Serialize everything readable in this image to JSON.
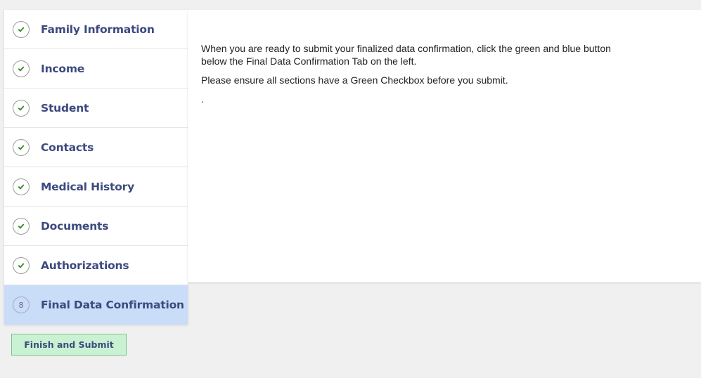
{
  "sidebar": {
    "items": [
      {
        "label": "Family Information",
        "status": "complete",
        "icon": "checkmark-icon"
      },
      {
        "label": "Income",
        "status": "complete",
        "icon": "checkmark-icon"
      },
      {
        "label": "Student",
        "status": "complete",
        "icon": "checkmark-icon"
      },
      {
        "label": "Contacts",
        "status": "complete",
        "icon": "checkmark-icon"
      },
      {
        "label": "Medical History",
        "status": "complete",
        "icon": "checkmark-icon"
      },
      {
        "label": "Documents",
        "status": "complete",
        "icon": "checkmark-icon"
      },
      {
        "label": "Authorizations",
        "status": "complete",
        "icon": "checkmark-icon"
      },
      {
        "label": "Final Data Confirmation",
        "status": "active",
        "step": "8"
      }
    ]
  },
  "content": {
    "paragraph_1": "When you are ready to submit your finalized data confirmation, click the green and blue button below the Final Data Confirmation Tab on the left.",
    "paragraph_2": "Please ensure all sections have a Green Checkbox before you submit.",
    "paragraph_3": "."
  },
  "finish_button": {
    "label": "Finish and Submit"
  },
  "colors": {
    "label_text": "#3d4a7f",
    "check_green": "#3a8a2c",
    "active_bg": "#c9ddf8",
    "button_bg": "#c9f2d2",
    "button_border": "#7bbf8c"
  }
}
